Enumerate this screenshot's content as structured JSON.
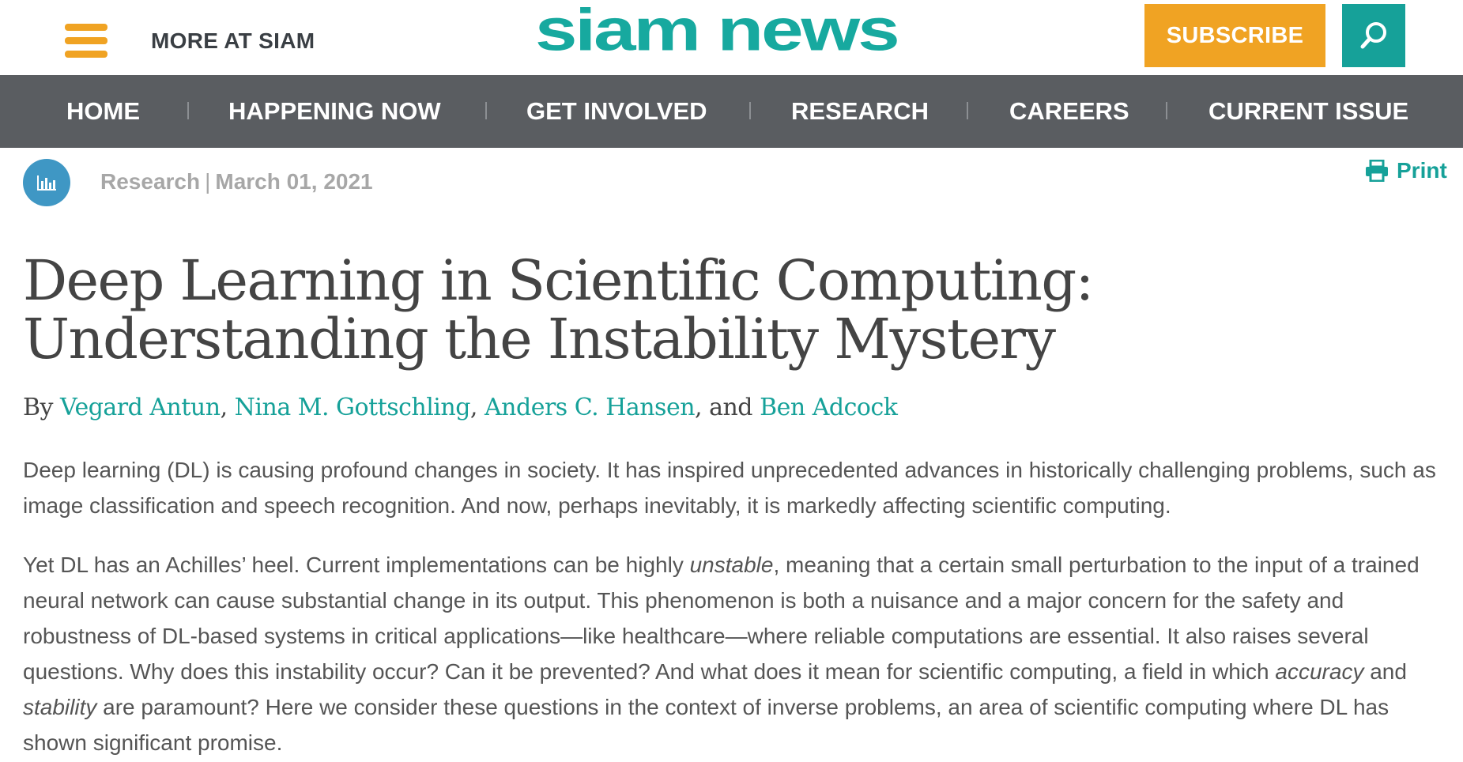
{
  "header": {
    "more_label": "MORE AT SIAM",
    "logo_text": "siam news",
    "subscribe_label": "SUBSCRIBE",
    "search_icon": "search-icon",
    "menu_icon": "hamburger-menu-icon",
    "brand_color": "#16a199",
    "accent_color": "#f0a323"
  },
  "nav": {
    "items": [
      {
        "label": "HOME"
      },
      {
        "label": "HAPPENING NOW"
      },
      {
        "label": "GET INVOLVED"
      },
      {
        "label": "RESEARCH"
      },
      {
        "label": "CAREERS"
      },
      {
        "label": "CURRENT ISSUE"
      }
    ],
    "background": "#5a5d61"
  },
  "meta": {
    "category": "Research",
    "separator": "|",
    "date": "March 01, 2021",
    "category_icon": "bar-chart-icon",
    "print_label": "Print",
    "print_icon": "printer-icon"
  },
  "article": {
    "title_line1": "Deep Learning in Scientific Computing:",
    "title_line2": "Understanding the Instability Mystery",
    "by_prefix": "By",
    "authors": [
      "Vegard Antun",
      "Nina M. Gottschling",
      "Anders C. Hansen",
      "Ben Adcock"
    ],
    "author_sep": ",",
    "and_text": ", and",
    "p1": "Deep learning (DL) is causing profound changes in society. It has inspired unprecedented advances in historically challenging problems, such as image classification and speech recognition. And now, perhaps inevitably, it is markedly affecting scientific computing.",
    "p2": {
      "s1": "Yet DL has an Achilles’ heel. Current implementations can be highly ",
      "em1": "unstable",
      "s2": ", meaning that a certain small perturbation to the input of a trained neural network can cause substantial change in its output. This phenomenon is both a nuisance and a major concern for the safety and robustness of DL-based systems in critical applications—like healthcare—where reliable computations are essential. It also raises several questions. Why does this instability occur? Can it be prevented? And what does it mean for scientific computing, a field in which ",
      "em2": "accuracy",
      "s3": " and ",
      "em3": "stability",
      "s4": " are paramount? Here we consider these questions in the context of inverse problems, an area of scientific computing where DL has shown significant promise."
    }
  }
}
